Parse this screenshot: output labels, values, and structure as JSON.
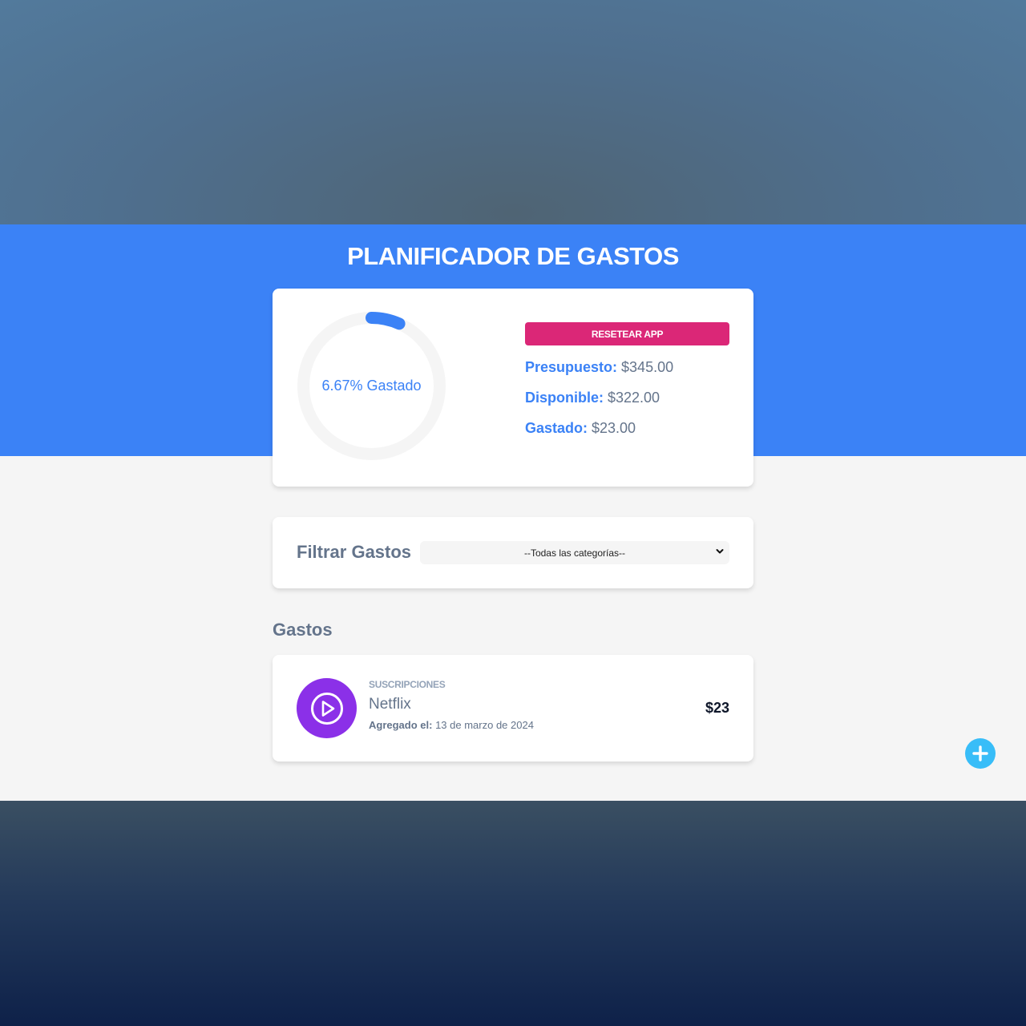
{
  "header": {
    "title": "PLANIFICADOR DE GASTOS",
    "accent_color": "#3b82f6"
  },
  "budget": {
    "progress_label": "6.67% Gastado",
    "progress_fraction": 0.0667,
    "reset_label": "RESETEAR APP",
    "reset_color": "#db2777",
    "presupuesto_key": "Presupuesto:",
    "presupuesto_value": " $345.00",
    "disponible_key": "Disponible:",
    "disponible_value": " $322.00",
    "gastado_key": "Gastado:",
    "gastado_value": " $23.00"
  },
  "filter": {
    "label": "Filtrar Gastos",
    "selected_option": "--Todas las categorías--"
  },
  "expenses": {
    "section_title": "Gastos",
    "items": [
      {
        "category": "SUSCRIPCIONES",
        "name": "Netflix",
        "date_key": "Agregado el:",
        "date_value": " 13 de marzo de 2024",
        "amount": "$23",
        "icon": "play-icon",
        "icon_color": "#8b30e8"
      }
    ]
  },
  "fab": {
    "icon": "plus-icon",
    "color": "#38bdf8"
  }
}
